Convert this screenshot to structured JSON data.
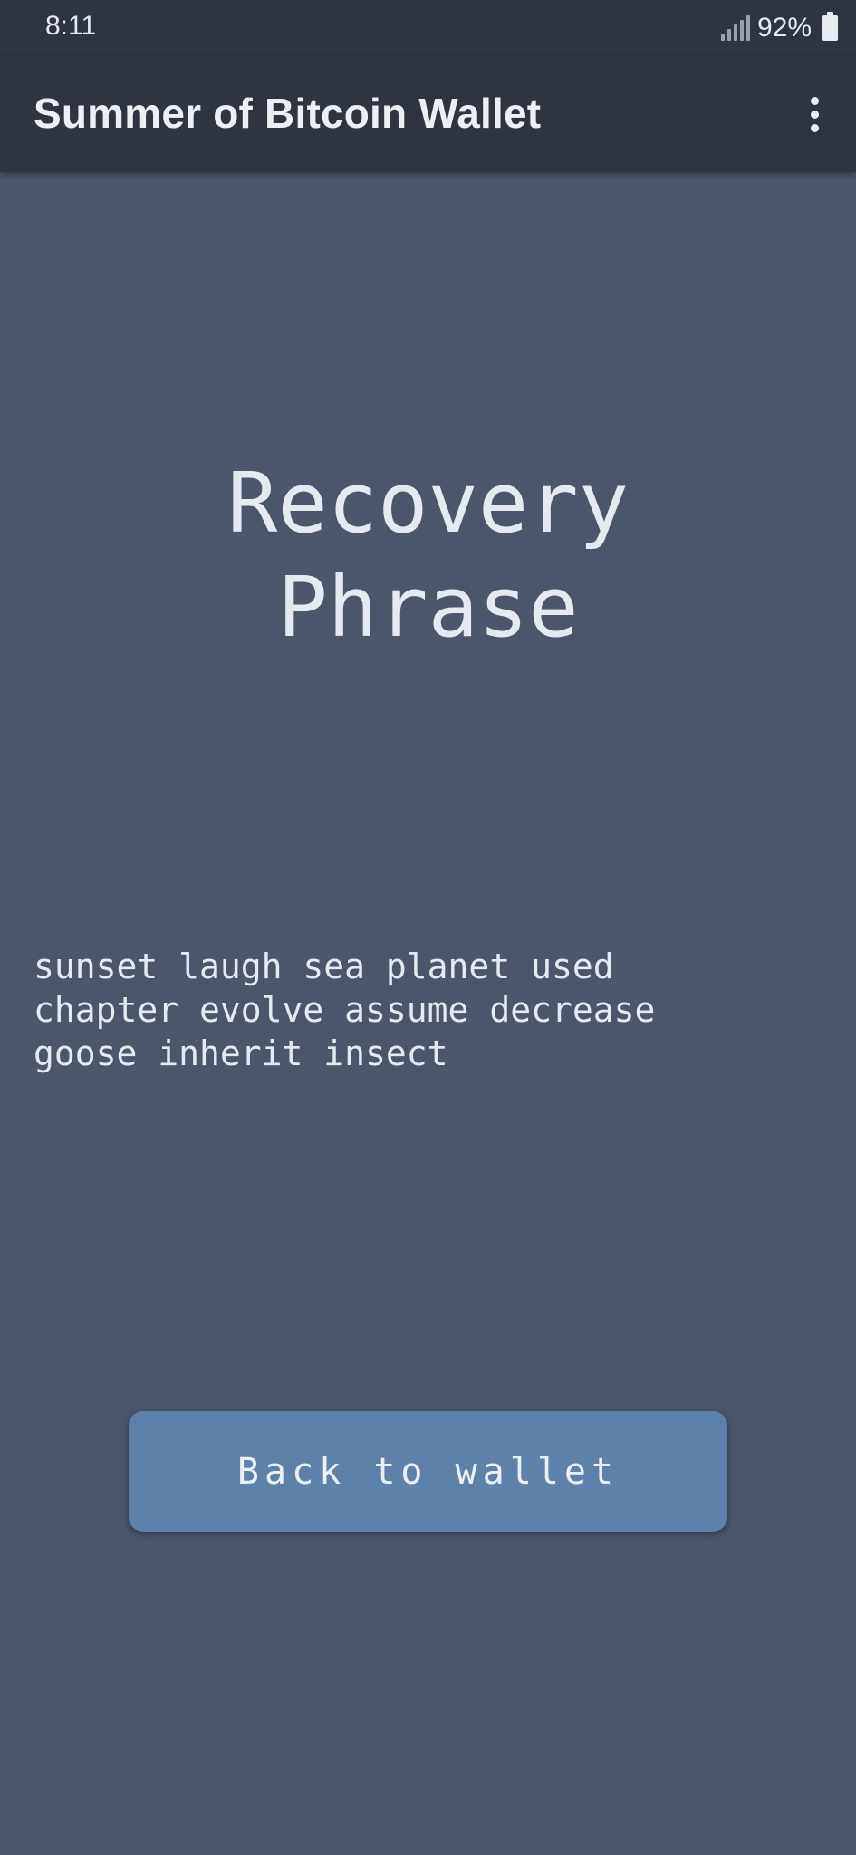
{
  "status_bar": {
    "time": "8:11",
    "battery_percent": "92%",
    "icons": [
      "signal-icon",
      "battery-icon"
    ]
  },
  "app_bar": {
    "title": "Summer of Bitcoin Wallet",
    "menu_icon": "more-vert-icon"
  },
  "screen": {
    "title": "Recovery\nPhrase",
    "phrase": "sunset laugh sea planet used\nchapter evolve assume decrease\ngoose inherit insect",
    "back_button_label": "Back to wallet"
  },
  "colors": {
    "background": "#4c566a",
    "app_bar": "#2e3440",
    "button": "#5e81ac",
    "text": "#e5e9f0"
  }
}
